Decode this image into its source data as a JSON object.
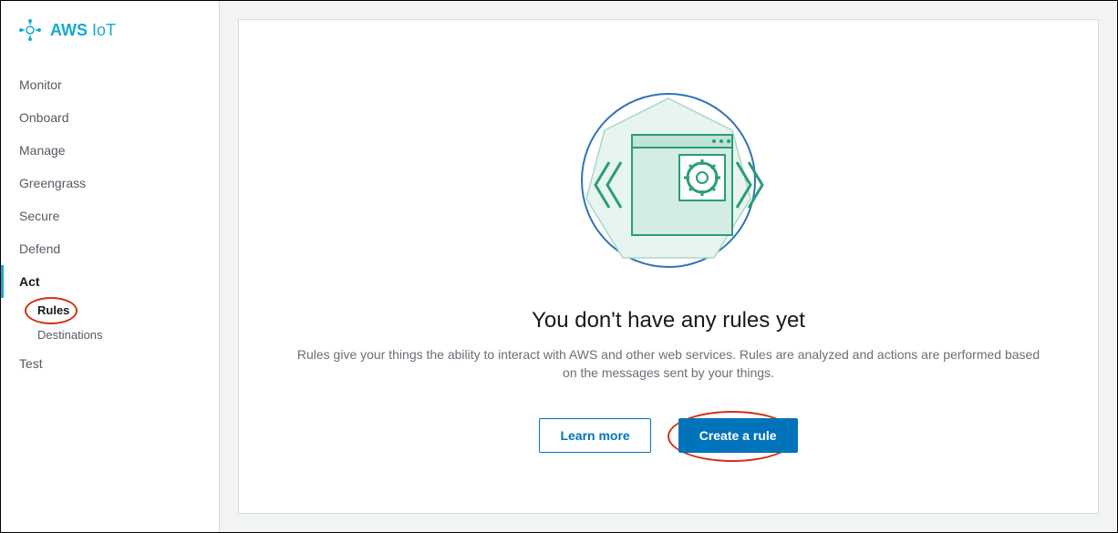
{
  "brand": {
    "bold": "AWS",
    "light": "IoT"
  },
  "sidebar": {
    "items": [
      {
        "label": "Monitor"
      },
      {
        "label": "Onboard"
      },
      {
        "label": "Manage"
      },
      {
        "label": "Greengrass"
      },
      {
        "label": "Secure"
      },
      {
        "label": "Defend"
      },
      {
        "label": "Act",
        "active": true
      },
      {
        "label": "Test"
      }
    ],
    "act_subitems": [
      {
        "label": "Rules",
        "highlighted": true
      },
      {
        "label": "Destinations"
      }
    ]
  },
  "main": {
    "heading": "You don't have any rules yet",
    "description": "Rules give your things the ability to interact with AWS and other web services. Rules are analyzed and actions are performed based on the messages sent by your things.",
    "learn_more_label": "Learn more",
    "create_rule_label": "Create a rule"
  }
}
